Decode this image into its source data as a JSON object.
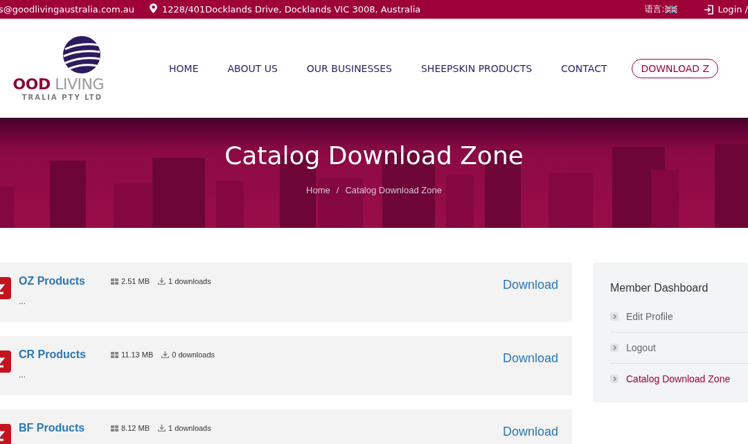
{
  "top_bar": {
    "email": "s@goodlivingaustralia.com.au",
    "address": "1228/401Docklands Drive, Docklands VIC 3008, Australia",
    "language_label": "语言:",
    "login": "Login /"
  },
  "logo": {
    "name_first": "OOD",
    "name_second": "LIVING",
    "subtitle": "TRALIA PTY LTD"
  },
  "nav": [
    {
      "label": "HOME",
      "kind": "link"
    },
    {
      "label": "ABOUT US",
      "kind": "link"
    },
    {
      "label": "OUR BUSINESSES",
      "kind": "link"
    },
    {
      "label": "SHEEPSKIN PRODUCTS",
      "kind": "link"
    },
    {
      "label": "CONTACT",
      "kind": "link"
    },
    {
      "label": "DOWNLOAD Z",
      "kind": "outlined"
    }
  ],
  "hero": {
    "title": "Catalog Download Zone",
    "breadcrumb": {
      "home": "Home",
      "separator": "/",
      "current": "Catalog Download Zone"
    }
  },
  "files": [
    {
      "title": "OZ Products",
      "size": "2.51 MB",
      "downloads": "1 downloads",
      "excerpt": "...",
      "action": "Download"
    },
    {
      "title": "CR Products",
      "size": "11.13 MB",
      "downloads": "0 downloads",
      "excerpt": "...",
      "action": "Download"
    },
    {
      "title": "BF Products",
      "size": "8.12 MB",
      "downloads": "1 downloads",
      "action": "Download"
    }
  ],
  "dashboard": {
    "title": "Member Dashboard",
    "items": [
      {
        "label": "Edit Profile",
        "selected": false
      },
      {
        "label": "Logout",
        "selected": false
      },
      {
        "label": "Catalog Download Zone",
        "selected": true
      }
    ]
  }
}
